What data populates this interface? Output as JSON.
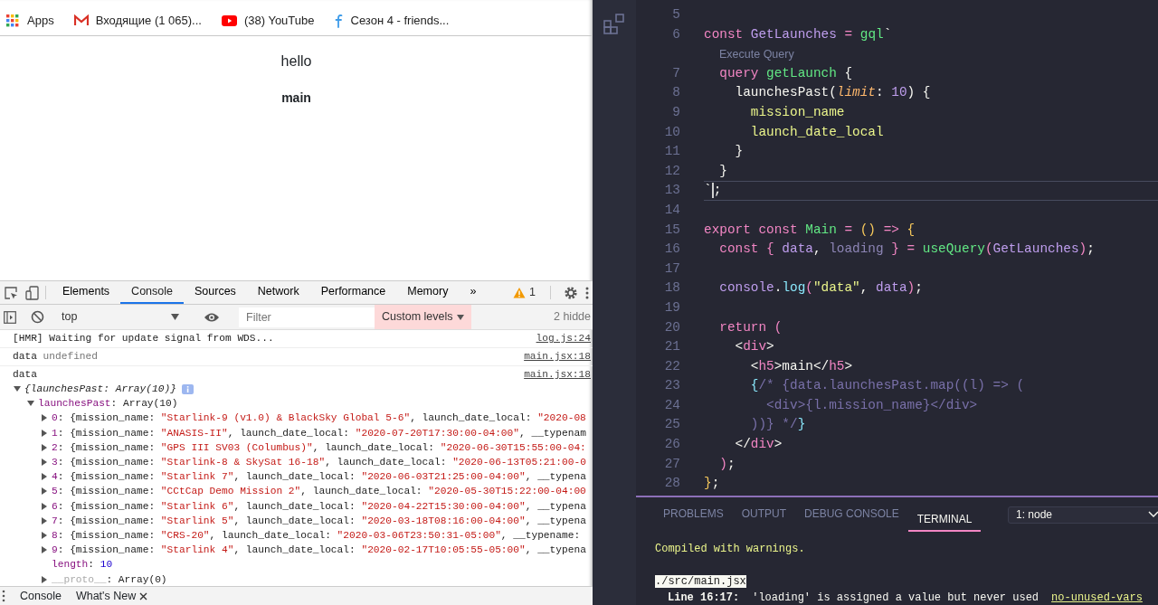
{
  "bookmarks": [
    {
      "kind": "apps",
      "label": "Apps"
    },
    {
      "kind": "mail",
      "label": "Входящие (1 065)..."
    },
    {
      "kind": "video",
      "label": "(38) YouTube"
    },
    {
      "kind": "site",
      "label": "Сезон 4 - friends..."
    }
  ],
  "page": {
    "heading": "hello",
    "subheading": "main"
  },
  "devtools": {
    "tabs": [
      {
        "label": "Elements",
        "selected": false
      },
      {
        "label": "Console",
        "selected": true
      },
      {
        "label": "Sources",
        "selected": false
      },
      {
        "label": "Network",
        "selected": false
      },
      {
        "label": "Performance",
        "selected": false
      },
      {
        "label": "Memory",
        "selected": false
      }
    ],
    "more_tabs": "»",
    "warnings": "1",
    "toolbar": {
      "context": "top",
      "filter_placeholder": "Filter",
      "levels": "Custom levels",
      "hidden": "2 hidde"
    },
    "drawer_tabs": [
      {
        "label": "Console",
        "closable": false
      },
      {
        "label": "What's New",
        "closable": true
      }
    ]
  },
  "console": {
    "messages": [
      {
        "tokens": [
          {
            "kind": "plain",
            "text": "[HMR] Waiting for update signal from WDS..."
          }
        ],
        "source": "log.js:24"
      },
      {
        "tokens": [
          {
            "kind": "plain",
            "text": "data "
          },
          {
            "kind": "undef",
            "text": "undefined"
          }
        ],
        "source": "main.jsx:18"
      },
      {
        "tokens": [
          {
            "kind": "plain",
            "text": "data"
          }
        ],
        "source": "main.jsx:18",
        "tree": {
          "summary": "{launchesPast: Array(10)}",
          "expanded": true,
          "children": [
            {
              "tokens": [
                {
                  "kind": "prop",
                  "text": "launchesPast"
                },
                {
                  "kind": "plain",
                  "text": ": Array(10)"
                }
              ],
              "expanded": true,
              "children": [
                {
                  "tokens": [
                    {
                      "kind": "idx",
                      "text": "0"
                    },
                    {
                      "kind": "plain",
                      "text": ": {mission_name: "
                    },
                    {
                      "kind": "str",
                      "text": "\"Starlink-9 (v1.0) & BlackSky Global 5-6\""
                    },
                    {
                      "kind": "plain",
                      "text": ", launch_date_local: "
                    },
                    {
                      "kind": "str",
                      "text": "\"2020-08"
                    }
                  ],
                  "expanded": false
                },
                {
                  "tokens": [
                    {
                      "kind": "idx",
                      "text": "1"
                    },
                    {
                      "kind": "plain",
                      "text": ": {mission_name: "
                    },
                    {
                      "kind": "str",
                      "text": "\"ANASIS-II\""
                    },
                    {
                      "kind": "plain",
                      "text": ", launch_date_local: "
                    },
                    {
                      "kind": "str",
                      "text": "\"2020-07-20T17:30:00-04:00\""
                    },
                    {
                      "kind": "plain",
                      "text": ", __typenam"
                    }
                  ],
                  "expanded": false
                },
                {
                  "tokens": [
                    {
                      "kind": "idx",
                      "text": "2"
                    },
                    {
                      "kind": "plain",
                      "text": ": {mission_name: "
                    },
                    {
                      "kind": "str",
                      "text": "\"GPS III SV03 (Columbus)\""
                    },
                    {
                      "kind": "plain",
                      "text": ", launch_date_local: "
                    },
                    {
                      "kind": "str",
                      "text": "\"2020-06-30T15:55:00-04:"
                    }
                  ],
                  "expanded": false
                },
                {
                  "tokens": [
                    {
                      "kind": "idx",
                      "text": "3"
                    },
                    {
                      "kind": "plain",
                      "text": ": {mission_name: "
                    },
                    {
                      "kind": "str",
                      "text": "\"Starlink-8 & SkySat 16-18\""
                    },
                    {
                      "kind": "plain",
                      "text": ", launch_date_local: "
                    },
                    {
                      "kind": "str",
                      "text": "\"2020-06-13T05:21:00-0"
                    }
                  ],
                  "expanded": false
                },
                {
                  "tokens": [
                    {
                      "kind": "idx",
                      "text": "4"
                    },
                    {
                      "kind": "plain",
                      "text": ": {mission_name: "
                    },
                    {
                      "kind": "str",
                      "text": "\"Starlink 7\""
                    },
                    {
                      "kind": "plain",
                      "text": ", launch_date_local: "
                    },
                    {
                      "kind": "str",
                      "text": "\"2020-06-03T21:25:00-04:00\""
                    },
                    {
                      "kind": "plain",
                      "text": ", __typena"
                    }
                  ],
                  "expanded": false
                },
                {
                  "tokens": [
                    {
                      "kind": "idx",
                      "text": "5"
                    },
                    {
                      "kind": "plain",
                      "text": ": {mission_name: "
                    },
                    {
                      "kind": "str",
                      "text": "\"CCtCap Demo Mission 2\""
                    },
                    {
                      "kind": "plain",
                      "text": ", launch_date_local: "
                    },
                    {
                      "kind": "str",
                      "text": "\"2020-05-30T15:22:00-04:00"
                    }
                  ],
                  "expanded": false
                },
                {
                  "tokens": [
                    {
                      "kind": "idx",
                      "text": "6"
                    },
                    {
                      "kind": "plain",
                      "text": ": {mission_name: "
                    },
                    {
                      "kind": "str",
                      "text": "\"Starlink 6\""
                    },
                    {
                      "kind": "plain",
                      "text": ", launch_date_local: "
                    },
                    {
                      "kind": "str",
                      "text": "\"2020-04-22T15:30:00-04:00\""
                    },
                    {
                      "kind": "plain",
                      "text": ", __typena"
                    }
                  ],
                  "expanded": false
                },
                {
                  "tokens": [
                    {
                      "kind": "idx",
                      "text": "7"
                    },
                    {
                      "kind": "plain",
                      "text": ": {mission_name: "
                    },
                    {
                      "kind": "str",
                      "text": "\"Starlink 5\""
                    },
                    {
                      "kind": "plain",
                      "text": ", launch_date_local: "
                    },
                    {
                      "kind": "str",
                      "text": "\"2020-03-18T08:16:00-04:00\""
                    },
                    {
                      "kind": "plain",
                      "text": ", __typena"
                    }
                  ],
                  "expanded": false
                },
                {
                  "tokens": [
                    {
                      "kind": "idx",
                      "text": "8"
                    },
                    {
                      "kind": "plain",
                      "text": ": {mission_name: "
                    },
                    {
                      "kind": "str",
                      "text": "\"CRS-20\""
                    },
                    {
                      "kind": "plain",
                      "text": ", launch_date_local: "
                    },
                    {
                      "kind": "str",
                      "text": "\"2020-03-06T23:50:31-05:00\""
                    },
                    {
                      "kind": "plain",
                      "text": ", __typename:"
                    }
                  ],
                  "expanded": false
                },
                {
                  "tokens": [
                    {
                      "kind": "idx",
                      "text": "9"
                    },
                    {
                      "kind": "plain",
                      "text": ": {mission_name: "
                    },
                    {
                      "kind": "str",
                      "text": "\"Starlink 4\""
                    },
                    {
                      "kind": "plain",
                      "text": ", launch_date_local: "
                    },
                    {
                      "kind": "str",
                      "text": "\"2020-02-17T10:05:55-05:00\""
                    },
                    {
                      "kind": "plain",
                      "text": ", __typena"
                    }
                  ],
                  "expanded": false
                },
                {
                  "tokens": [
                    {
                      "kind": "prop",
                      "text": "length"
                    },
                    {
                      "kind": "plain",
                      "text": ": "
                    },
                    {
                      "kind": "num",
                      "text": "10"
                    }
                  ]
                },
                {
                  "tokens": [
                    {
                      "kind": "dim",
                      "text": "__proto__"
                    },
                    {
                      "kind": "plain",
                      "text": ": Array(0)"
                    }
                  ],
                  "expanded": false
                }
              ]
            }
          ]
        }
      }
    ]
  },
  "editor": {
    "lines": [
      {
        "kind": "code",
        "number": "5",
        "current": false
      },
      {
        "kind": "code",
        "number": "6",
        "current": false,
        "tokens": [
          {
            "kind": "kw",
            "text": "const "
          },
          {
            "kind": "var",
            "text": "GetLaunches "
          },
          {
            "kind": "kw",
            "text": "= "
          },
          {
            "kind": "fn",
            "text": "gql"
          },
          {
            "kind": "plain",
            "text": "`"
          }
        ]
      },
      {
        "kind": "lens",
        "text": "Execute Query"
      },
      {
        "kind": "code",
        "number": "7",
        "current": false,
        "tokens": [
          {
            "kind": "kw",
            "text": "  query "
          },
          {
            "kind": "fn",
            "text": "getLaunch "
          },
          {
            "kind": "plain",
            "text": "{"
          }
        ]
      },
      {
        "kind": "code",
        "number": "8",
        "current": false,
        "tokens": [
          {
            "kind": "plain",
            "text": "    launchesPast("
          },
          {
            "kind": "param",
            "text": "limit"
          },
          {
            "kind": "plain",
            "text": ": "
          },
          {
            "kind": "num",
            "text": "10"
          },
          {
            "kind": "plain",
            "text": ") {"
          }
        ]
      },
      {
        "kind": "code",
        "number": "9",
        "current": false,
        "tokens": [
          {
            "kind": "field",
            "text": "      mission_name"
          }
        ]
      },
      {
        "kind": "code",
        "number": "10",
        "current": false,
        "tokens": [
          {
            "kind": "field",
            "text": "      launch_date_local"
          }
        ]
      },
      {
        "kind": "code",
        "number": "11",
        "current": false,
        "tokens": [
          {
            "kind": "plain",
            "text": "    }"
          }
        ]
      },
      {
        "kind": "code",
        "number": "12",
        "current": false,
        "tokens": [
          {
            "kind": "plain",
            "text": "  }"
          }
        ]
      },
      {
        "kind": "code",
        "number": "13",
        "current": true,
        "tokens": [
          {
            "kind": "plain",
            "text": "`"
          },
          {
            "kind": "cursor"
          },
          {
            "kind": "plain",
            "text": ";"
          }
        ]
      },
      {
        "kind": "code",
        "number": "14",
        "current": false
      },
      {
        "kind": "code",
        "number": "15",
        "current": false,
        "tokens": [
          {
            "kind": "kw",
            "text": "export const "
          },
          {
            "kind": "fn",
            "text": "Main "
          },
          {
            "kind": "kw",
            "text": "= "
          },
          {
            "kind": "brace",
            "text": "() "
          },
          {
            "kind": "kw",
            "text": "=> "
          },
          {
            "kind": "brace",
            "text": "{"
          }
        ]
      },
      {
        "kind": "code",
        "number": "16",
        "current": false,
        "tokens": [
          {
            "kind": "kw",
            "text": "  const { "
          },
          {
            "kind": "var",
            "text": "data"
          },
          {
            "kind": "plain",
            "text": ", "
          },
          {
            "kind": "unused",
            "text": "loading"
          },
          {
            "kind": "kw",
            "text": " } = "
          },
          {
            "kind": "fn",
            "text": "useQuery"
          },
          {
            "kind": "kw",
            "text": "("
          },
          {
            "kind": "var",
            "text": "GetLaunches"
          },
          {
            "kind": "kw",
            "text": ")"
          },
          {
            "kind": "plain",
            "text": ";"
          }
        ]
      },
      {
        "kind": "code",
        "number": "17",
        "current": false
      },
      {
        "kind": "code",
        "number": "18",
        "current": false,
        "tokens": [
          {
            "kind": "var",
            "text": "  console"
          },
          {
            "kind": "plain",
            "text": "."
          },
          {
            "kind": "method",
            "text": "log"
          },
          {
            "kind": "kw",
            "text": "("
          },
          {
            "kind": "str",
            "text": "\"data\""
          },
          {
            "kind": "plain",
            "text": ", "
          },
          {
            "kind": "var",
            "text": "data"
          },
          {
            "kind": "kw",
            "text": ")"
          },
          {
            "kind": "plain",
            "text": ";"
          }
        ]
      },
      {
        "kind": "code",
        "number": "19",
        "current": false
      },
      {
        "kind": "code",
        "number": "20",
        "current": false,
        "tokens": [
          {
            "kind": "kw",
            "text": "  return ("
          }
        ]
      },
      {
        "kind": "code",
        "number": "21",
        "current": false,
        "tokens": [
          {
            "kind": "plain",
            "text": "    <"
          },
          {
            "kind": "kw",
            "text": "div"
          },
          {
            "kind": "plain",
            "text": ">"
          }
        ]
      },
      {
        "kind": "code",
        "number": "22",
        "current": false,
        "tokens": [
          {
            "kind": "plain",
            "text": "      <"
          },
          {
            "kind": "kw",
            "text": "h5"
          },
          {
            "kind": "plain",
            "text": ">main</"
          },
          {
            "kind": "kw",
            "text": "h5"
          },
          {
            "kind": "plain",
            "text": ">"
          }
        ]
      },
      {
        "kind": "code",
        "number": "23",
        "current": false,
        "tokens": [
          {
            "kind": "method",
            "text": "      {"
          },
          {
            "kind": "cm",
            "text": "/* {data.launchesPast.map((l) => ("
          }
        ]
      },
      {
        "kind": "code",
        "number": "24",
        "current": false,
        "tokens": [
          {
            "kind": "cm",
            "text": "        <div>{l.mission_name}</div>"
          }
        ]
      },
      {
        "kind": "code",
        "number": "25",
        "current": false,
        "tokens": [
          {
            "kind": "cm",
            "text": "      ))} */"
          },
          {
            "kind": "method",
            "text": "}"
          }
        ]
      },
      {
        "kind": "code",
        "number": "26",
        "current": false,
        "tokens": [
          {
            "kind": "plain",
            "text": "    </"
          },
          {
            "kind": "kw",
            "text": "div"
          },
          {
            "kind": "plain",
            "text": ">"
          }
        ]
      },
      {
        "kind": "code",
        "number": "27",
        "current": false,
        "tokens": [
          {
            "kind": "kw",
            "text": "  )"
          },
          {
            "kind": "plain",
            "text": ";"
          }
        ]
      },
      {
        "kind": "code",
        "number": "28",
        "current": false,
        "tokens": [
          {
            "kind": "brace",
            "text": "}"
          },
          {
            "kind": "plain",
            "text": ";"
          }
        ]
      }
    ]
  },
  "panel": {
    "tabs": [
      {
        "label": "PROBLEMS",
        "selected": false
      },
      {
        "label": "OUTPUT",
        "selected": false
      },
      {
        "label": "DEBUG CONSOLE",
        "selected": false
      },
      {
        "label": "TERMINAL",
        "selected": true
      }
    ],
    "terminal_select": "1: node",
    "output": [
      {
        "kind": "warning",
        "text": "Compiled with warnings."
      },
      {
        "kind": "file",
        "text": "./src/main.jsx"
      },
      {
        "kind": "lint",
        "location": "Line 16:17:",
        "message": "'loading' is assigned a value but never used",
        "rule": "no-unused-vars"
      }
    ]
  }
}
